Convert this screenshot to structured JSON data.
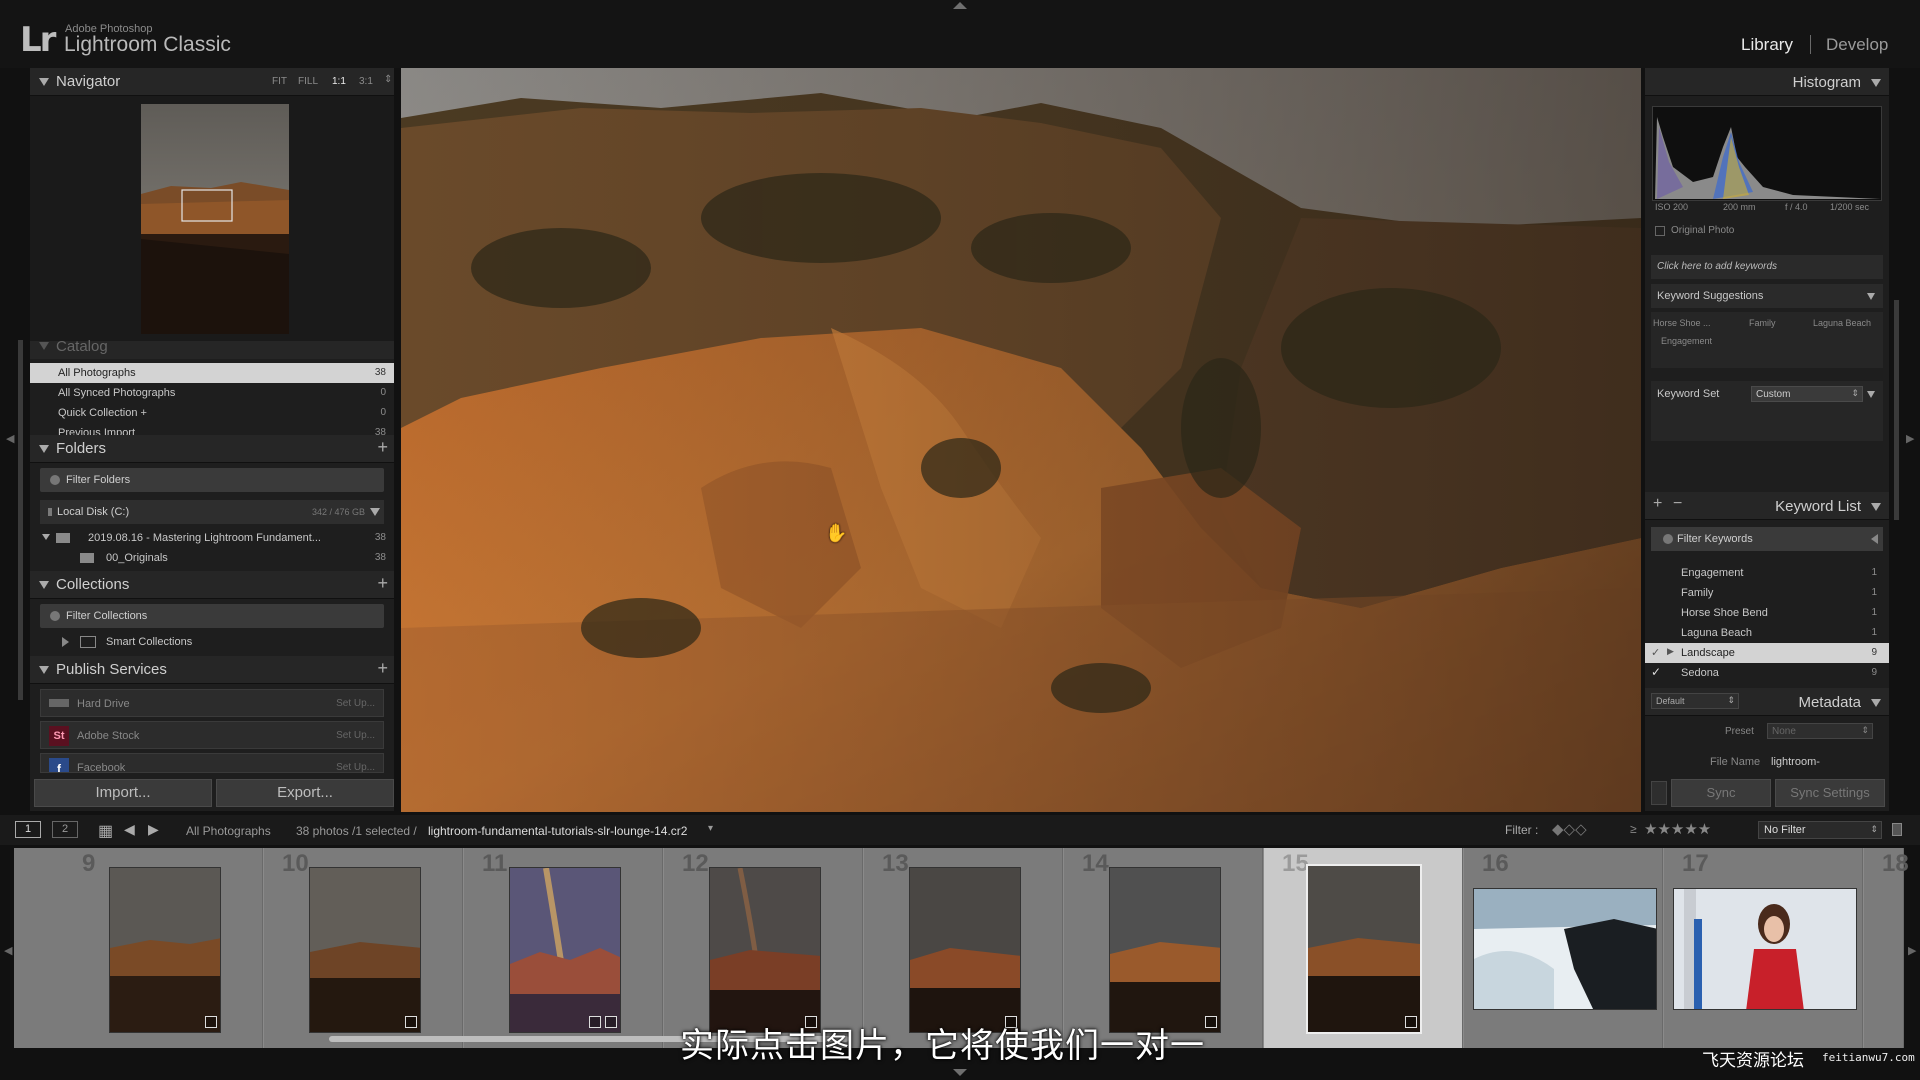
{
  "app": {
    "brand": "Lr",
    "vendor": "Adobe Photoshop",
    "name": "Lightroom Classic"
  },
  "modules": {
    "library": "Library",
    "develop": "Develop"
  },
  "navigator": {
    "title": "Navigator",
    "zoom": [
      "FIT",
      "FILL",
      "1:1",
      "3:1"
    ]
  },
  "catalog": {
    "title": "Catalog",
    "items": [
      {
        "label": "All Photographs",
        "count": "38"
      },
      {
        "label": "All Synced Photographs",
        "count": "0"
      },
      {
        "label": "Quick Collection  +",
        "count": "0"
      },
      {
        "label": "Previous Import",
        "count": "38"
      }
    ]
  },
  "folders": {
    "title": "Folders",
    "filter_placeholder": "Filter Folders",
    "disk": {
      "label": "Local Disk (C:)",
      "space": "342 / 476 GB"
    },
    "items": [
      {
        "label": "2019.08.16 - Mastering Lightroom Fundament...",
        "count": "38"
      },
      {
        "label": "00_Originals",
        "count": "38"
      }
    ]
  },
  "collections": {
    "title": "Collections",
    "filter_placeholder": "Filter Collections",
    "smart": "Smart Collections"
  },
  "publish": {
    "title": "Publish Services",
    "items": [
      {
        "label": "Hard Drive",
        "action": "Set Up..."
      },
      {
        "label": "Adobe Stock",
        "action": "Set Up...",
        "icon_text": "St"
      },
      {
        "label": "Facebook",
        "action": "Set Up..."
      }
    ]
  },
  "buttons": {
    "import": "Import...",
    "export": "Export...",
    "sync": "Sync",
    "sync_settings": "Sync Settings"
  },
  "histogram": {
    "title": "Histogram",
    "iso": "ISO 200",
    "focal": "200 mm",
    "aperture": "f / 4.0",
    "shutter": "1/200 sec",
    "original_photo": "Original Photo"
  },
  "keywording": {
    "add_placeholder": "Click here to add keywords",
    "suggestions_label": "Keyword Suggestions",
    "suggestions": [
      "Horse Shoe ...",
      "Family",
      "Laguna Beach",
      "Engagement"
    ],
    "set_label": "Keyword Set",
    "set_value": "Custom"
  },
  "keyword_list": {
    "title": "Keyword List",
    "filter_placeholder": "Filter Keywords",
    "items": [
      {
        "label": "Engagement",
        "count": "1"
      },
      {
        "label": "Family",
        "count": "1"
      },
      {
        "label": "Horse Shoe Bend",
        "count": "1"
      },
      {
        "label": "Laguna Beach",
        "count": "1"
      },
      {
        "label": "Landscape",
        "count": "9"
      },
      {
        "label": "Sedona",
        "count": "9"
      }
    ]
  },
  "metadata": {
    "title": "Metadata",
    "preset_dropdown": "Default",
    "preset_label": "Preset",
    "preset_value": "None",
    "filename_label": "File Name",
    "filename_value": "lightroom-"
  },
  "filmstrip_bar": {
    "view1": "1",
    "view2": "2",
    "source": "All Photographs",
    "count": "38 photos /1 selected /",
    "filename": "lightroom-fundamental-tutorials-slr-lounge-14.cr2",
    "filter_label": "Filter :",
    "filter_value": "No Filter"
  },
  "filmstrip": {
    "numbers": [
      "9",
      "10",
      "11",
      "12",
      "13",
      "14",
      "15",
      "16",
      "17",
      "18"
    ]
  },
  "overlay": {
    "subtitle": "实际点击图片，它将使我们一对一",
    "watermark": "飞天资源论坛",
    "watermark_url": "feitianwu7.com"
  }
}
